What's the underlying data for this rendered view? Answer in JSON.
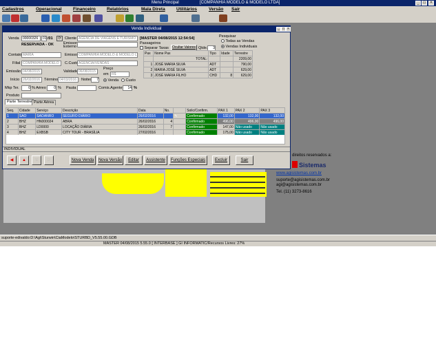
{
  "app": {
    "title": "Menu Principal",
    "company": "[COMPANHIA MODELO & MODELO LTDA]"
  },
  "menu": [
    "Cadastros",
    "Operacional",
    "Financeiro",
    "Relatórios",
    "Mala Direta",
    "Utilitários",
    "Versão",
    "Sair"
  ],
  "window": {
    "title": "Venda Individual"
  },
  "form": {
    "venda_label": "Venda",
    "venda_value": "00000326",
    "venda_seq": "01",
    "venda_year": "/01",
    "status": "RESERVADA - OK",
    "cliente_label": "Cliente",
    "cliente_value": "AGENCIA DE VIAGENS E TURISMO",
    "emissor_externo_label": "Emissor Externo",
    "contato_label": "Contato",
    "contato_value": "MARIA",
    "emissor_label": "Emissor",
    "emissor_value": "COMPANHIA MODELO & MODELO LT",
    "filial_label": "Filial",
    "filial_value": "COMPANHIA MODELO",
    "ccusto_label": "C.Custo",
    "ccusto_value": "AGENCIA/VENDAS",
    "emissao_label": "Emissão",
    "emissao_value": "04/08/2015",
    "validade_label": "Validade",
    "validade_value": "06/08/2015",
    "preco_label": "Preço",
    "preco_em_label": "em",
    "preco_value": "R$",
    "inicio_label": "Início",
    "inicio_value": "26/02/2016",
    "termino_label": "Término",
    "termino_value": "04/03/2016",
    "noites_label": "Noites",
    "noites_value": "7",
    "venda_radio": "Venda",
    "custo_radio": "Custo",
    "mkp_label": "Mkp Ter.",
    "mkp_value": "0",
    "aereo_label": "% Aéreo",
    "aereo_value": "0",
    "pct": "%",
    "pauta_label": "Pauta",
    "comis_label": "Comis.Agente",
    "comis_value": "14",
    "comis_pct": "%",
    "produto_label": "Produto"
  },
  "header_info": "[MASTER 04/08/2015 12:54:54]",
  "passengers": {
    "label": "Passageiros",
    "separar_label": "Separar Taxas",
    "ocultar_button": "Ocultar Valores",
    "qtde_label": "Qtde.",
    "qtde_value": "3",
    "columns": [
      "Pax",
      "Nome Pax",
      "Tipo",
      "Idade",
      "Terrestre"
    ],
    "total_label": "TOTAL:",
    "total_value": "2209,00",
    "rows": [
      {
        "n": "1",
        "name": "JOSÉ MARIA SILVA",
        "tipo": "ADT",
        "idade": "",
        "valor": "790,00"
      },
      {
        "n": "2",
        "name": "MARIA JOSÉ SILVA",
        "tipo": "ADT",
        "idade": "",
        "valor": "629,00"
      },
      {
        "n": "3",
        "name": "JOSÉ MARIA FILHO",
        "tipo": "CHD",
        "idade": "8",
        "valor": "629,00"
      }
    ]
  },
  "pesquisar": {
    "label": "Pesquisar",
    "opt1": "Todas as Vendas",
    "opt2": "Vendas Individuais"
  },
  "tabs": [
    "Parte Terrestre",
    "Parte Aérea"
  ],
  "services": {
    "columns": [
      "Seq.",
      "Cidade",
      "Serviço",
      "Descrição",
      "Data",
      "No.",
      "",
      "Solic/Confirm.",
      "PAX 1",
      "PAX 2",
      "PAX 3"
    ],
    "rows": [
      {
        "seq": "1",
        "cidade": "SAO",
        "servico": "SAOANRO",
        "desc": "SEGURO DIÁRIO",
        "data": "26/02/2016",
        "no": "",
        "st": "Confirmado",
        "p1": "132,00",
        "p2": "132,00",
        "p3": "132,00"
      },
      {
        "seq": "2",
        "cidade": "BHZ",
        "servico": "HN000024",
        "desc": "ABRA",
        "data": "26/02/2016",
        "no": "4",
        "st": "Confirmado",
        "p1": "496,00",
        "p2": "496,00",
        "p3": "496,00"
      },
      {
        "seq": "3",
        "cidade": "BHZ",
        "servico": "LD0000",
        "desc": "LOCAÇÃO DIÁRIA",
        "data": "26/02/2016",
        "no": "7",
        "st": "Confirmado",
        "p1": "147,00",
        "p2": "Não usado",
        "p3": "Não usado"
      },
      {
        "seq": "4",
        "cidade": "BHZ",
        "servico": "EXBSB",
        "desc": "CITY TOUR - BRASÍLIA",
        "data": "27/02/2016",
        "no": "",
        "st": "Confirmado",
        "p1": "175,00",
        "p2": "Não usado",
        "p3": "Não usado"
      }
    ]
  },
  "footer_status": "INDIVIDUAL",
  "buttons": {
    "nova_venda": "Nova Venda",
    "nova_versao": "Nova Versão",
    "editar": "Editar",
    "assistente": "Assistente",
    "funcoes": "Funções Especiais",
    "excluir": "Excluir",
    "sair": "Sair"
  },
  "logo": {
    "rights": "direitos reservados a:",
    "brand": "Sistemas",
    "site": "www.agisistemas.com.br",
    "email1": "suporte@agisistemas.com.br",
    "email2": "agi@agisistemas.com.br",
    "phone": "Tel. (11) 3273-8616"
  },
  "status1": "suporte-edivaldo:D:\\Agi\\Sturwin\\CiaModelo\\STURBD_V5.55.00.GDB",
  "status2": "MASTER        04/08/2015 5.55.0 [ INTERBASE ] GI INFORMATIC/Recursos Livres: 27%"
}
